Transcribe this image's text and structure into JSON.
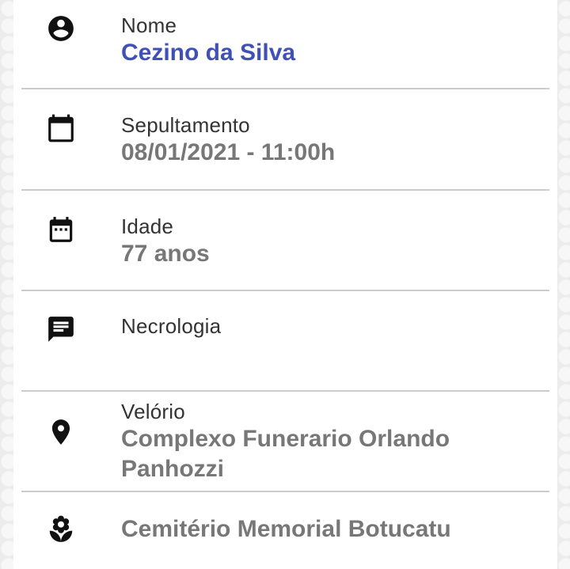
{
  "colors": {
    "accent": "#3f51b5",
    "value": "#777777",
    "label": "#333333",
    "divider": "#cccccc"
  },
  "fields": [
    {
      "icon": "account-circle-icon",
      "label": "Nome",
      "value": "Cezino da Silva"
    },
    {
      "icon": "calendar-icon",
      "label": "Sepultamento",
      "value": "08/01/2021 - 11:00h"
    },
    {
      "icon": "calendar-dots-icon",
      "label": "Idade",
      "value": "77 anos"
    },
    {
      "icon": "message-icon",
      "label": "Necrologia",
      "value": ""
    },
    {
      "icon": "location-pin-icon",
      "label": "Velório",
      "value": "Complexo Funerario Orlando Panhozzi"
    },
    {
      "icon": "flower-icon",
      "label": "",
      "value": "Cemitério Memorial Botucatu"
    }
  ]
}
